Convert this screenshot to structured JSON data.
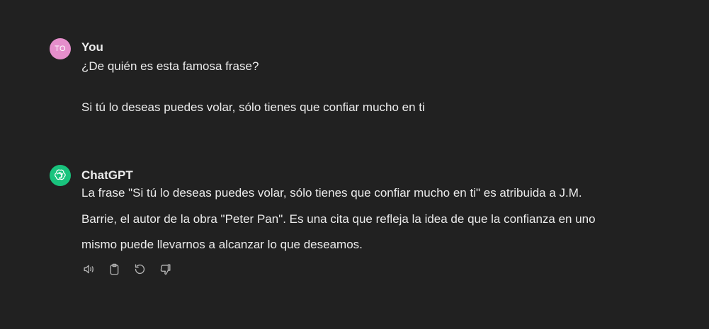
{
  "user_message": {
    "avatar_initials": "TO",
    "author": "You",
    "lines": [
      "¿De quién es esta famosa frase?",
      "Si tú lo deseas puedes volar, sólo tienes que confiar mucho en ti"
    ]
  },
  "assistant_message": {
    "author": "ChatGPT",
    "lines": [
      "La frase \"Si tú lo deseas puedes volar, sólo tienes que confiar mucho en ti\" es atribuida a J.M.",
      "Barrie, el autor de la obra \"Peter Pan\". Es una cita que refleja la idea de que la confianza en uno",
      "mismo puede llevarnos a alcanzar lo que deseamos."
    ],
    "actions": [
      {
        "icon": "speaker-icon"
      },
      {
        "icon": "clipboard-icon"
      },
      {
        "icon": "regenerate-icon"
      },
      {
        "icon": "thumbs-down-icon"
      }
    ]
  },
  "colors": {
    "background": "#212121",
    "text": "#ececec",
    "user_avatar": "#e58ecb",
    "assistant_avatar": "#19c37d",
    "icon": "#b4b4b4"
  }
}
